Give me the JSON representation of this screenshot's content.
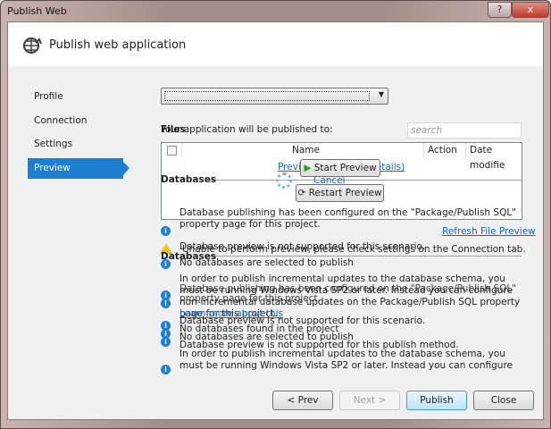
{
  "window": {
    "title": "Publish Web",
    "help_label": "?",
    "close_label": "x"
  },
  "header": {
    "icon": "globe-publish-icon",
    "title": "Publish web application"
  },
  "sidebar": {
    "items": [
      {
        "label": "Profile"
      },
      {
        "label": "Connection"
      },
      {
        "label": "Settings"
      },
      {
        "label": "Preview",
        "selected": true
      }
    ]
  },
  "main": {
    "profile_dropdown_value": "",
    "files_label": "Files",
    "published_to_label": "Your application will be published to:",
    "search_placeholder": "search",
    "columns": [
      "Name",
      "Action",
      "Date modifie"
    ],
    "preview_link": "Preview",
    "details_link": "(details)",
    "cancel_link": "Cancel",
    "start_preview": "Start Preview",
    "restart_preview": "Restart Preview",
    "databases_heading": "Databases",
    "refresh_link": "Refresh File Preview",
    "messages": [
      "Database publishing has been configured on the \"Package/Publish SQL\" property page for this project.",
      "Database preview is not supported for this scenario.",
      "Unable to perform preview, please check settings on the Connection tab.",
      "No databases are selected to publish",
      "In order to publish incremental updates to the database schema, you must be running Windows Vista SP2 or later. Instead you can configure non-incremental database updates on the Package/Publish SQL property page for this project.",
      "Learn more about this",
      "Database preview is not supported for this scenario.",
      "No databases found in the project",
      "No databases are selected to publish",
      "Database preview is not supported for this publish method.",
      "In order to publish incremental updates to the database schema, you must be running Windows Vista SP2 or later. Instead you can configure non-incremental database updates on the Package/Publish SQL property page for this project."
    ]
  },
  "footer": {
    "prev": "< Prev",
    "next": "Next >",
    "publish": "Publish",
    "close": "Close"
  },
  "colors": {
    "accent": "#1e7fd0",
    "info": "#1b80d8",
    "link": "#1a64c8"
  }
}
